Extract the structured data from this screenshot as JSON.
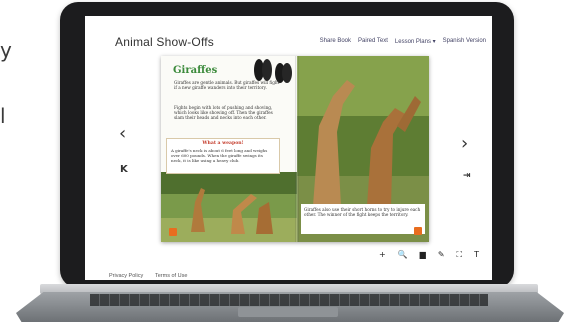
{
  "background": {
    "left_fragment_top": "y",
    "left_fragment_bottom": "l"
  },
  "app": {
    "title": "Animal Show-Offs"
  },
  "nav": {
    "share_book": "Share Book",
    "paired_text": "Paired Text",
    "lesson_plans": "Lesson Plans ▾",
    "spanish_version": "Spanish Version"
  },
  "book": {
    "heading": "Giraffes",
    "para1": "Giraffes are gentle animals. But giraffes will fight if a new giraffe wanders into their territory.",
    "para2": "Fights begin with lots of pushing and shoving, which looks like showing off. Then the giraffes slam their heads and necks into each other.",
    "callout_title": "What a weapon!",
    "callout_body": "A giraffe's neck is about 6 feet long and weighs over 600 pounds. When the giraffe swings its neck, it is like using a heavy club.",
    "caption": "Giraffes also use their short horns to try to injure each other. The winner of the fight keeps the territory."
  },
  "controls": {
    "prev_arrow": "‹",
    "next_arrow": "›",
    "first_page": "K",
    "last_page": "⇥",
    "zoom_in": "+",
    "search": "🔍",
    "highlight": "▆",
    "annotate": "✎",
    "fullscreen": "⛶",
    "text_size": "T"
  },
  "footer": {
    "privacy": "Privacy Policy",
    "terms": "Terms of Use"
  },
  "colors": {
    "heading_green": "#3b8a3b",
    "callout_red": "#c43b2b",
    "orange_button": "#e86d1f",
    "bezel": "#1c1c1e"
  }
}
